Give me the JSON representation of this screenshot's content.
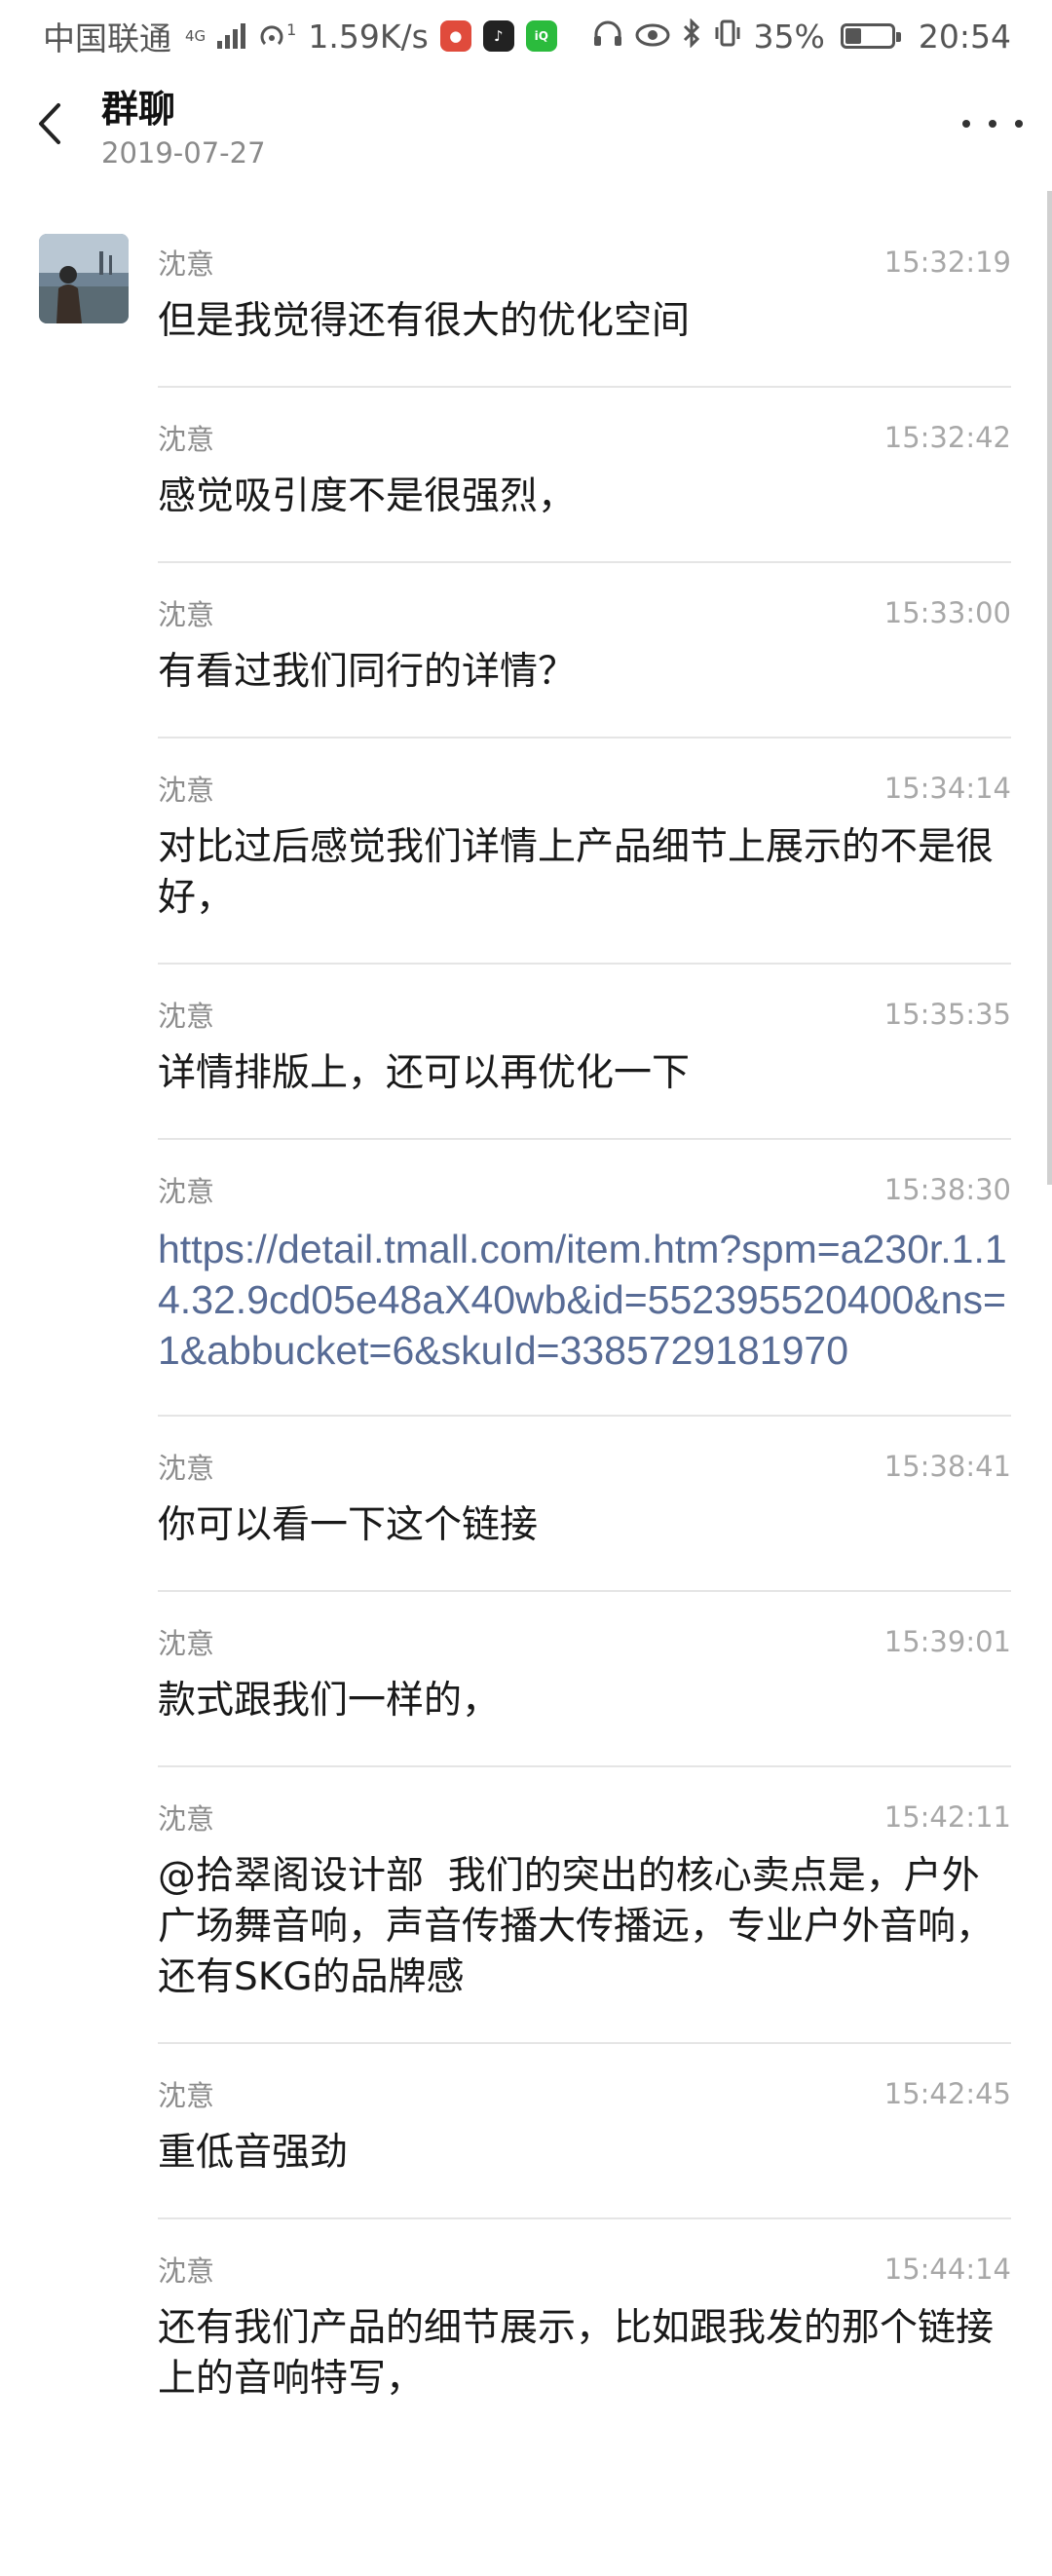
{
  "status_bar": {
    "carrier": "中国联通",
    "network_type": "4G",
    "hotspot_sup": "1",
    "speed": "1.59K/s",
    "battery": "35%",
    "battery_level": 0.35,
    "time": "20:54"
  },
  "header": {
    "title": "群聊",
    "date": "2019-07-27"
  },
  "messages": [
    {
      "sender": "沈意",
      "time": "15:32:19",
      "text": "但是我觉得还有很大的优化空间"
    },
    {
      "sender": "沈意",
      "time": "15:32:42",
      "text": "感觉吸引度不是很强烈，"
    },
    {
      "sender": "沈意",
      "time": "15:33:00",
      "text": "有看过我们同行的详情？"
    },
    {
      "sender": "沈意",
      "time": "15:34:14",
      "text": "对比过后感觉我们详情上产品细节上展示的不是很好，"
    },
    {
      "sender": "沈意",
      "time": "15:35:35",
      "text": "详情排版上，还可以再优化一下"
    },
    {
      "sender": "沈意",
      "time": "15:38:30",
      "text": "https://detail.tmall.com/item.htm?spm=a230r.1.14.32.9cd05e48aX40wb&id=552395520400&ns=1&abbucket=6&skuId=3385729181970",
      "is_link": true
    },
    {
      "sender": "沈意",
      "time": "15:38:41",
      "text": "你可以看一下这个链接"
    },
    {
      "sender": "沈意",
      "time": "15:39:01",
      "text": "款式跟我们一样的，"
    },
    {
      "sender": "沈意",
      "time": "15:42:11",
      "text": "@拾翠阁设计部  我们的突出的核心卖点是，户外 广场舞音响，声音传播大传播远，专业户外音响，还有SKG的品牌感"
    },
    {
      "sender": "沈意",
      "time": "15:42:45",
      "text": "重低音强劲"
    },
    {
      "sender": "沈意",
      "time": "15:44:14",
      "text": "还有我们产品的细节展示，比如跟我发的那个链接上的音响特写，"
    }
  ],
  "icons": {
    "back": "back-arrow-icon",
    "more": "more-dots-icon"
  },
  "colors": {
    "link": "#576b95",
    "divider": "#e5e5e5",
    "meta_text": "#8c8c8c"
  }
}
